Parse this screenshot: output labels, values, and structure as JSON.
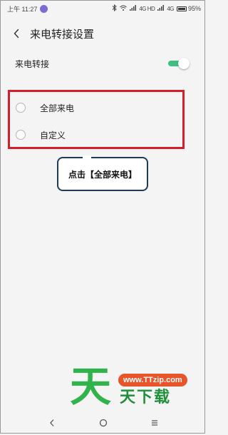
{
  "status_bar": {
    "time": "上午 11:27",
    "network_left": "4G HD",
    "network_right": "4G",
    "battery": "95%"
  },
  "header": {
    "title": "来电转接设置"
  },
  "forwarding": {
    "label": "来电转接",
    "enabled": true
  },
  "options": [
    {
      "label": "全部来电",
      "selected": false
    },
    {
      "label": "自定义",
      "selected": false
    }
  ],
  "annotation": {
    "text": "点击【全部来电】"
  },
  "watermark": {
    "big": "天",
    "url": "www.TTzip.com",
    "sub": "天下载"
  },
  "nav": {
    "back_glyph": "‹",
    "home_glyph": "○",
    "menu_glyph": "≡"
  },
  "colors": {
    "accent": "#3fbf7f",
    "highlight": "#d21f2a",
    "callout_border": "#1f3a5c",
    "watermark_green": "#2fb34a",
    "watermark_orange": "#e8552b"
  }
}
